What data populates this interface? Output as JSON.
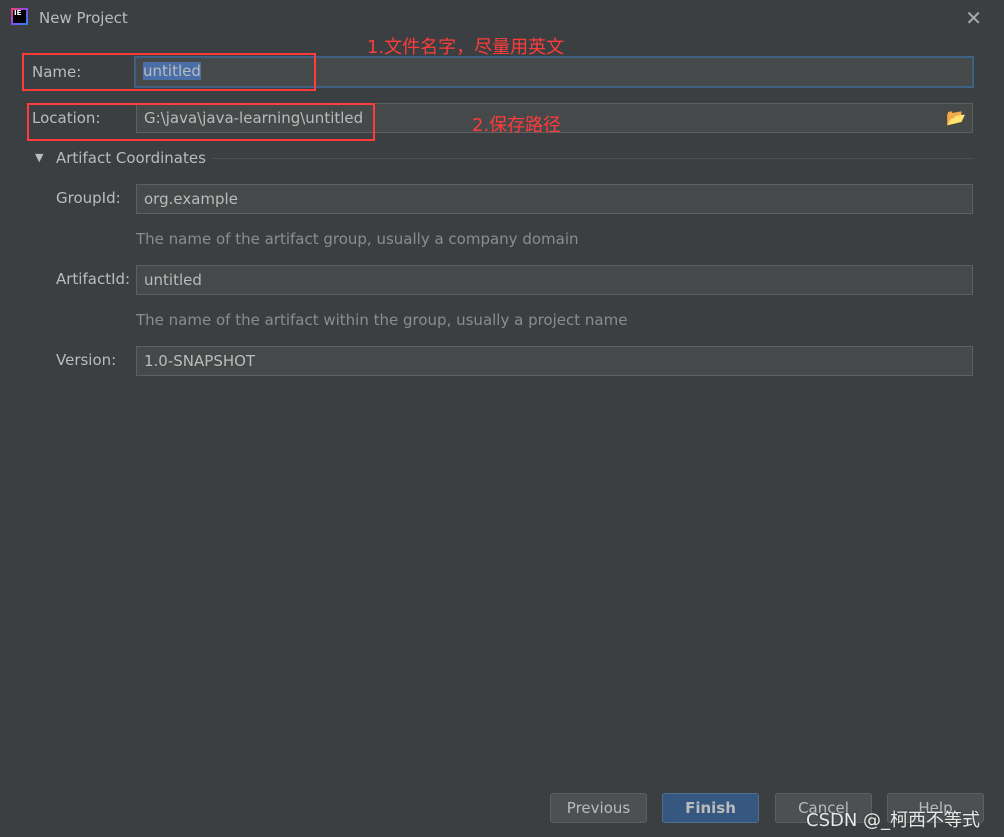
{
  "window": {
    "title": "New Project",
    "logo_text": "IE"
  },
  "form": {
    "name_label": "Name:",
    "name_value": "untitled",
    "location_label": "Location:",
    "location_value": "G:\\java\\java-learning\\untitled",
    "section_title": "Artifact Coordinates",
    "group_label": "GroupId:",
    "group_value": "org.example",
    "group_hint": "The name of the artifact group, usually a company domain",
    "artifact_label": "ArtifactId:",
    "artifact_value": "untitled",
    "artifact_hint": "The name of the artifact within the group, usually a project name",
    "version_label": "Version:",
    "version_value": "1.0-SNAPSHOT"
  },
  "annotations": {
    "name_note": "1.文件名字，尽量用英文",
    "location_note": "2.保存路径"
  },
  "buttons": {
    "previous": "Previous",
    "finish": "Finish",
    "cancel": "Cancel",
    "help": "Help"
  },
  "watermark": "CSDN @_柯西不等式",
  "colors": {
    "background": "#3c3f41",
    "annotation": "#ff3b3b",
    "primary_button": "#365880",
    "focus_border": "#3d6185"
  }
}
